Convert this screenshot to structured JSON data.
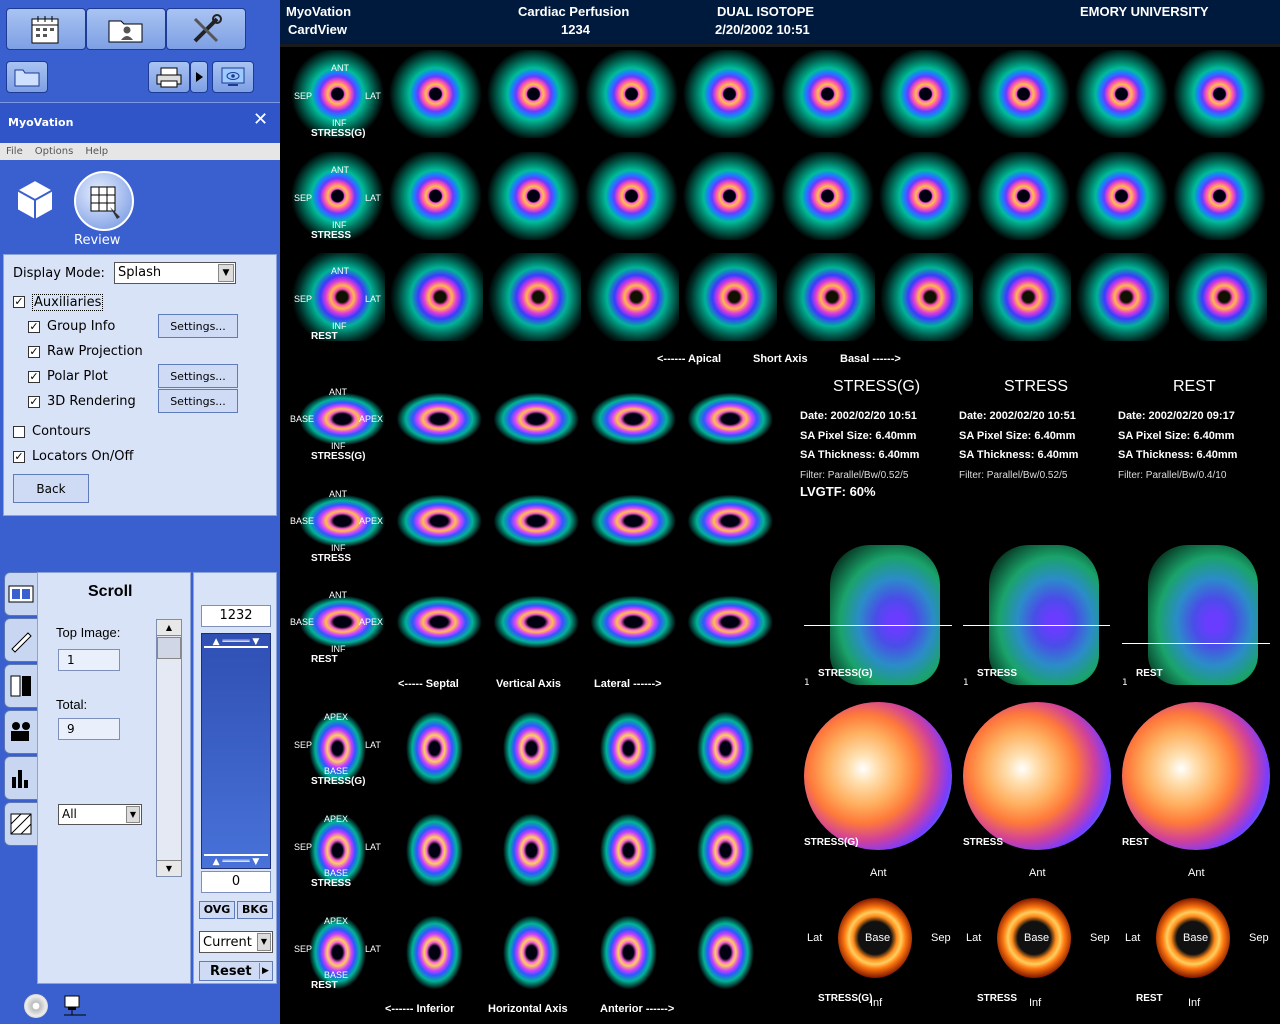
{
  "header": {
    "app_line1": "MyoVation",
    "app_line2": "CardView",
    "study_line1": "Cardiac Perfusion",
    "study_line2": "1234",
    "isotope_line1": "DUAL ISOTOPE",
    "isotope_line2": "2/20/2002 10:51",
    "institution": "EMORY UNIVERSITY"
  },
  "toolbar": {
    "icons": [
      "calendar-icon",
      "patient-folder-icon",
      "tools-icon",
      "open-folder-icon",
      "printer-icon",
      "play-arrow-icon",
      "monitor-icon"
    ]
  },
  "panel": {
    "title": "MyoVation",
    "close": "✕",
    "menu": [
      "File",
      "Options",
      "Help"
    ],
    "review_label": "Review"
  },
  "display": {
    "mode_label": "Display Mode:",
    "mode_value": "Splash",
    "items": [
      {
        "label": "Auxiliaries",
        "checked": true
      },
      {
        "label": "Group Info",
        "checked": true
      },
      {
        "label": "Raw Projection",
        "checked": true
      },
      {
        "label": "Polar Plot",
        "checked": true
      },
      {
        "label": "3D Rendering",
        "checked": true
      },
      {
        "label": "Contours",
        "checked": false
      },
      {
        "label": "Locators On/Off",
        "checked": true
      }
    ],
    "settings_label": "Settings...",
    "back_label": "Back"
  },
  "scroll": {
    "title": "Scroll",
    "top_label": "Top Image:",
    "top_value": "1",
    "total_label": "Total:",
    "total_value": "9",
    "filter_value": "All",
    "upper_value": "1232",
    "lower_value": "0",
    "ovg_label": "OVG",
    "bkg_label": "BKG",
    "current_value": "Current",
    "reset_label": "Reset"
  },
  "slices": {
    "short_axis": {
      "rows": [
        {
          "name": "STRESS(G)",
          "labels": [
            "ANT",
            "SEP",
            "LAT",
            "INF"
          ]
        },
        {
          "name": "STRESS",
          "labels": [
            "ANT",
            "SEP",
            "LAT",
            "INF"
          ]
        },
        {
          "name": "REST",
          "labels": [
            "ANT",
            "SEP",
            "LAT",
            "INF"
          ]
        }
      ],
      "caption_left": "<------ Apical",
      "caption_mid": "Short Axis",
      "caption_right": "Basal ------>"
    },
    "vertical_long_axis": {
      "rows": [
        {
          "name": "STRESS(G)",
          "labels": [
            "ANT",
            "BASE",
            "APEX",
            "INF"
          ]
        },
        {
          "name": "STRESS",
          "labels": [
            "ANT",
            "BASE",
            "APEX",
            "INF"
          ]
        },
        {
          "name": "REST",
          "labels": [
            "ANT",
            "BASE",
            "APEX",
            "INF"
          ]
        }
      ],
      "caption_left": "<----- Septal",
      "caption_mid": "Vertical Axis",
      "caption_right": "Lateral ------>"
    },
    "horizontal_long_axis": {
      "rows": [
        {
          "name": "STRESS(G)",
          "labels": [
            "APEX",
            "SEP",
            "LAT",
            "BASE"
          ]
        },
        {
          "name": "STRESS",
          "labels": [
            "APEX",
            "SEP",
            "LAT",
            "BASE"
          ]
        },
        {
          "name": "REST",
          "labels": [
            "APEX",
            "SEP",
            "LAT",
            "BASE"
          ]
        }
      ],
      "caption_left": "<------ Inferior",
      "caption_mid": "Horizontal Axis",
      "caption_right": "Anterior ------>"
    }
  },
  "studies": [
    {
      "title": "STRESS(G)",
      "date": "Date: 2002/02/20 10:51",
      "pixel": "SA Pixel Size: 6.40mm",
      "thickness": "SA Thickness: 6.40mm",
      "filter": "Filter: Parallel/Bw/0.52/5",
      "extra": "LVGTF: 60%",
      "proj_label": "STRESS(G)",
      "proj_num": "1",
      "polar_label": "STRESS(G)",
      "ant": "Ant",
      "lat": "Lat",
      "base": "Base",
      "sep": "Sep",
      "inf": "Inf",
      "bulls_label": "STRESS(G)"
    },
    {
      "title": "STRESS",
      "date": "Date: 2002/02/20 10:51",
      "pixel": "SA Pixel Size: 6.40mm",
      "thickness": "SA Thickness: 6.40mm",
      "filter": "Filter: Parallel/Bw/0.52/5",
      "extra": "",
      "proj_label": "STRESS",
      "proj_num": "1",
      "polar_label": "STRESS",
      "ant": "Ant",
      "lat": "Lat",
      "base": "Base",
      "sep": "Sep",
      "inf": "Inf",
      "bulls_label": "STRESS"
    },
    {
      "title": "REST",
      "date": "Date: 2002/02/20 09:17",
      "pixel": "SA Pixel Size: 6.40mm",
      "thickness": "SA Thickness: 6.40mm",
      "filter": "Filter: Parallel/Bw/0.4/10",
      "extra": "",
      "proj_label": "REST",
      "proj_num": "1",
      "polar_label": "REST",
      "ant": "Ant",
      "lat": "Lat",
      "base": "Base",
      "sep": "Sep",
      "inf": "Inf",
      "bulls_label": "REST"
    }
  ],
  "colors": {
    "panel_blue": "#3a5fcf",
    "header_bg": "#001a3d",
    "pane_bg": "#d9e3f7"
  }
}
